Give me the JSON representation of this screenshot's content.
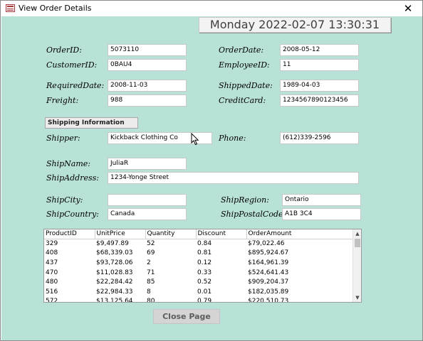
{
  "window": {
    "title": "View Order Details",
    "close_glyph": "✕"
  },
  "datetime": "Monday 2022-02-07 13:30:31",
  "order": {
    "order_id_label": "OrderID:",
    "order_id": "5073110",
    "order_date_label": "OrderDate:",
    "order_date": "2008-05-12",
    "customer_id_label": "CustomerID:",
    "customer_id": "0BAU4",
    "employee_id_label": "EmployeeID:",
    "employee_id": "11",
    "required_date_label": "RequiredDate:",
    "required_date": "2008-11-03",
    "shipped_date_label": "ShippedDate:",
    "shipped_date": "1989-04-03",
    "freight_label": "Freight:",
    "freight": "988",
    "credit_card_label": "CreditCard:",
    "credit_card": "1234567890123456"
  },
  "shipping": {
    "section_label": "Shipping Information",
    "shipper_label": "Shipper:",
    "shipper": "Kickback Clothing Co",
    "phone_label": "Phone:",
    "phone": "(612)339-2596",
    "ship_name_label": "ShipName:",
    "ship_name": "JuliaR",
    "ship_address_label": "ShipAddress:",
    "ship_address": "1234-Yonge Street",
    "ship_city_label": "ShipCity:",
    "ship_city": "",
    "ship_region_label": "ShipRegion:",
    "ship_region": "Ontario",
    "ship_country_label": "ShipCountry:",
    "ship_country": "Canada",
    "ship_postal_code_label": "ShipPostalCode:",
    "ship_postal_code": "A1B 3C4"
  },
  "details": {
    "columns": [
      "ProductID",
      "UnitPrice",
      "Quantity",
      "Discount",
      "OrderAmount"
    ],
    "rows": [
      [
        "329",
        "$9,497.89",
        "52",
        "0.84",
        "$79,022.46"
      ],
      [
        "408",
        "$68,339.03",
        "69",
        "0.81",
        "$895,924.67"
      ],
      [
        "437",
        "$93,728.06",
        "2",
        "0.12",
        "$164,961.39"
      ],
      [
        "470",
        "$11,028.83",
        "71",
        "0.33",
        "$524,641.43"
      ],
      [
        "480",
        "$22,284.42",
        "85",
        "0.52",
        "$909,204.37"
      ],
      [
        "516",
        "$22,984.33",
        "8",
        "0.01",
        "$182,035.89"
      ],
      [
        "572",
        "$13,125.64",
        "80",
        "0.79",
        "$220,510.73"
      ]
    ],
    "scroll_up": "▲",
    "scroll_down": "▼"
  },
  "buttons": {
    "close_page": "Close Page"
  },
  "icons": {
    "app": "form-icon",
    "cursor": "mouse-pointer-icon"
  }
}
